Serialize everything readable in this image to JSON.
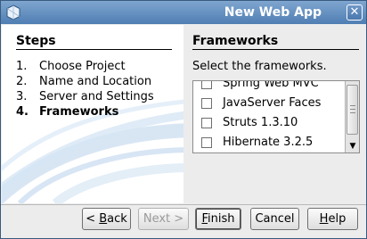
{
  "window": {
    "title": "New Web App",
    "close_glyph": "✕",
    "icon": "app-icon"
  },
  "steps_panel": {
    "title": "Steps",
    "items": [
      {
        "number": "1.",
        "label": "Choose Project",
        "current": false
      },
      {
        "number": "2.",
        "label": "Name and Location",
        "current": false
      },
      {
        "number": "3.",
        "label": "Server and Settings",
        "current": false
      },
      {
        "number": "4.",
        "label": "Frameworks",
        "current": true
      }
    ]
  },
  "frameworks_panel": {
    "title": "Frameworks",
    "instruction": "Select the frameworks.",
    "items": [
      {
        "label": "Spring Web MVC",
        "checked": false
      },
      {
        "label": "JavaServer Faces",
        "checked": false
      },
      {
        "label": "Struts 1.3.10",
        "checked": false
      },
      {
        "label": "Hibernate 3.2.5",
        "checked": false
      }
    ]
  },
  "buttons": {
    "back": {
      "label": "< Back",
      "mnemonic": "B",
      "enabled": true
    },
    "next": {
      "label": "Next >",
      "enabled": false
    },
    "finish": {
      "label": "Finish",
      "mnemonic": "F",
      "enabled": true,
      "default": true
    },
    "cancel": {
      "label": "Cancel",
      "enabled": true
    },
    "help": {
      "label": "Help",
      "mnemonic": "H",
      "enabled": true
    }
  },
  "colors": {
    "titlebar": "#5a86b9",
    "panel_bg": "#ececec"
  }
}
